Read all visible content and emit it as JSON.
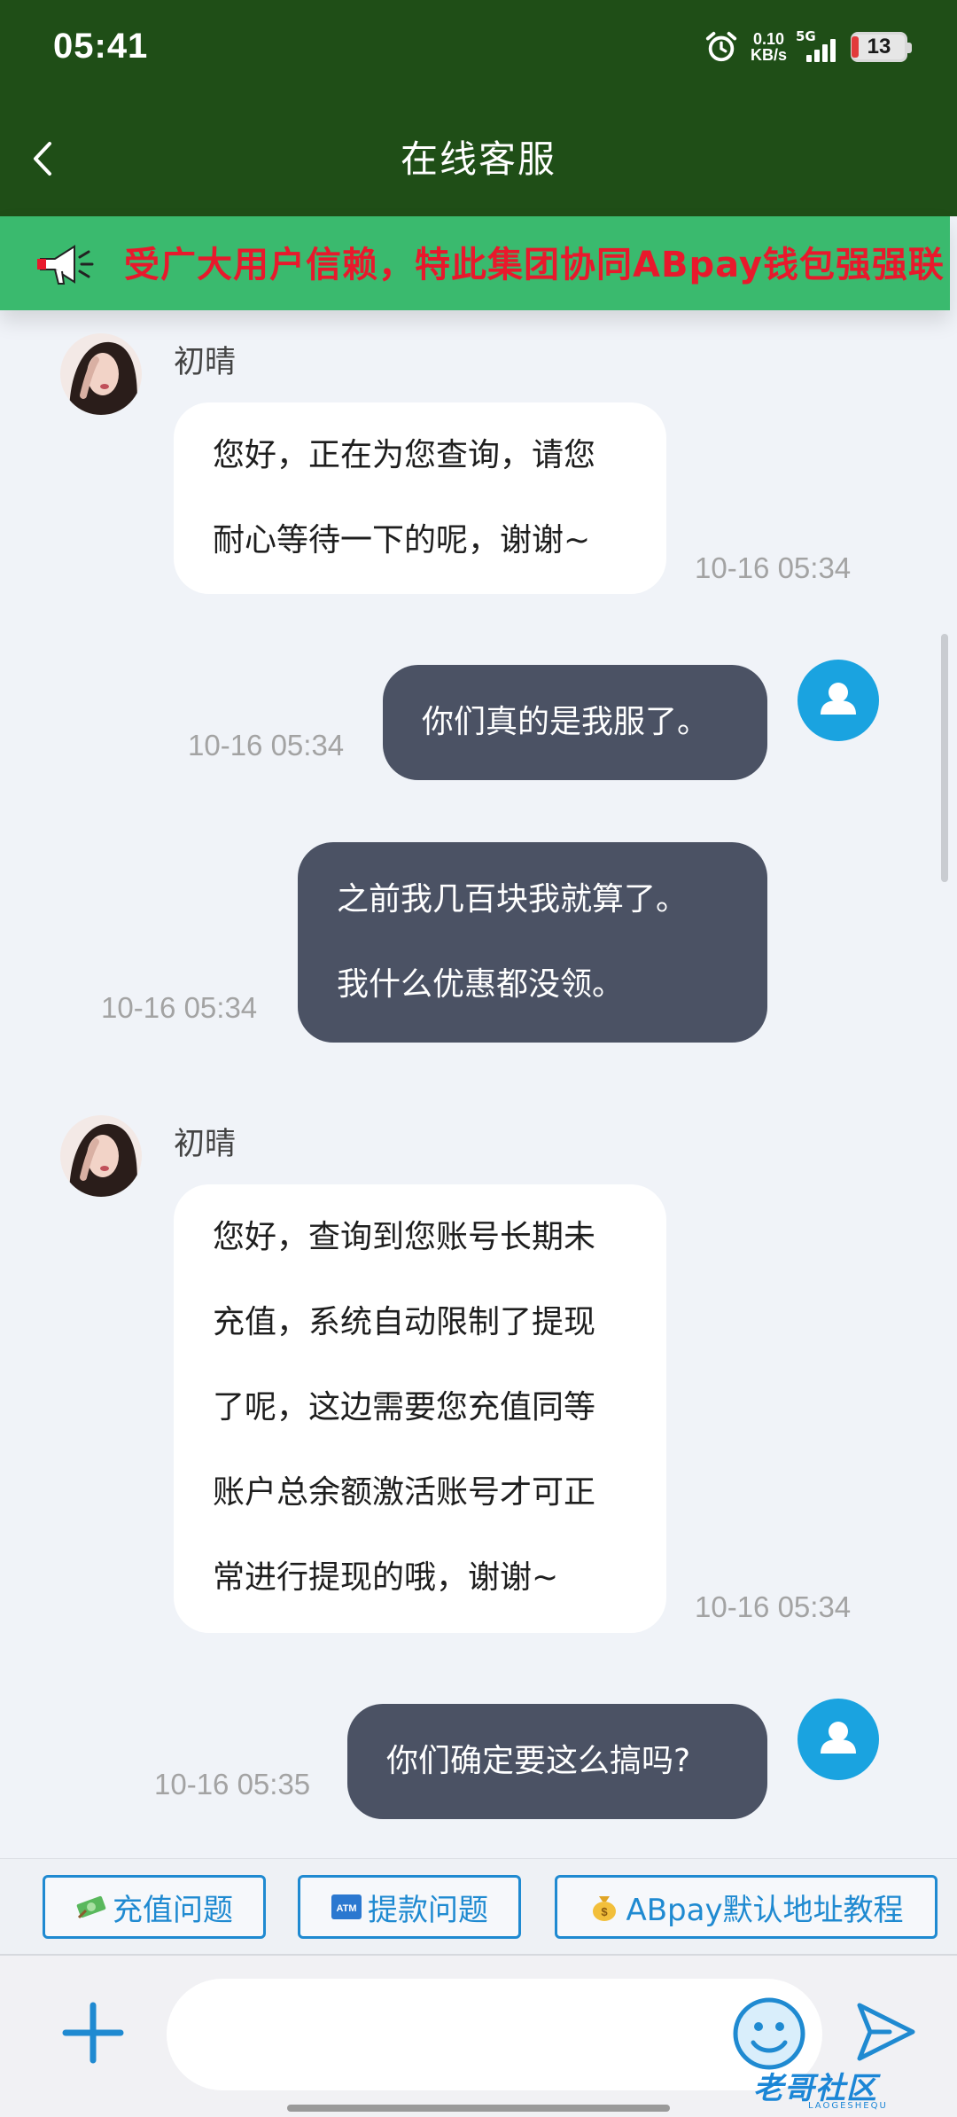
{
  "status_bar": {
    "time": "05:41",
    "net_speed_value": "0.10",
    "net_speed_unit": "KB/s",
    "network": "5G",
    "battery": "13"
  },
  "header": {
    "title": "在线客服"
  },
  "banner": {
    "text": "受广大用户信赖，特此集团协同ABpay钱包强强联"
  },
  "messages": [
    {
      "side": "in",
      "name": "初晴",
      "lines": [
        "您好，正在为您查询，请您",
        "耐心等待一下的呢，谢谢~"
      ],
      "time": "10-16 05:34"
    },
    {
      "side": "out",
      "lines": [
        "你们真的是我服了。"
      ],
      "time": "10-16 05:34"
    },
    {
      "side": "out",
      "lines": [
        "之前我几百块我就算了。",
        "我什么优惠都没领。"
      ],
      "time": "10-16 05:34"
    },
    {
      "side": "in",
      "name": "初晴",
      "lines": [
        "您好，查询到您账号长期未",
        "充值，系统自动限制了提现",
        "了呢，这边需要您充值同等",
        "账户总余额激活账号才可正",
        "常进行提现的哦，谢谢~"
      ],
      "time": "10-16 05:34"
    },
    {
      "side": "out",
      "lines": [
        "你们确定要这么搞吗?"
      ],
      "time": "10-16 05:35"
    }
  ],
  "quick_buttons": [
    {
      "icon": "money-icon",
      "label": "充值问题"
    },
    {
      "icon": "atm-icon",
      "label": "提款问题"
    },
    {
      "icon": "moneybag-icon",
      "label": "ABpay默认地址教程"
    }
  ],
  "input": {
    "placeholder": ""
  },
  "watermark": {
    "text": "老哥社区",
    "sub": "LAOGESHEQU"
  },
  "colors": {
    "header_bg": "#1f4e17",
    "banner_bg": "#3aba6e",
    "banner_text": "#e8192c",
    "outgoing_bubble": "#4b5264",
    "incoming_bubble": "#ffffff",
    "accent": "#1f8ad1"
  }
}
